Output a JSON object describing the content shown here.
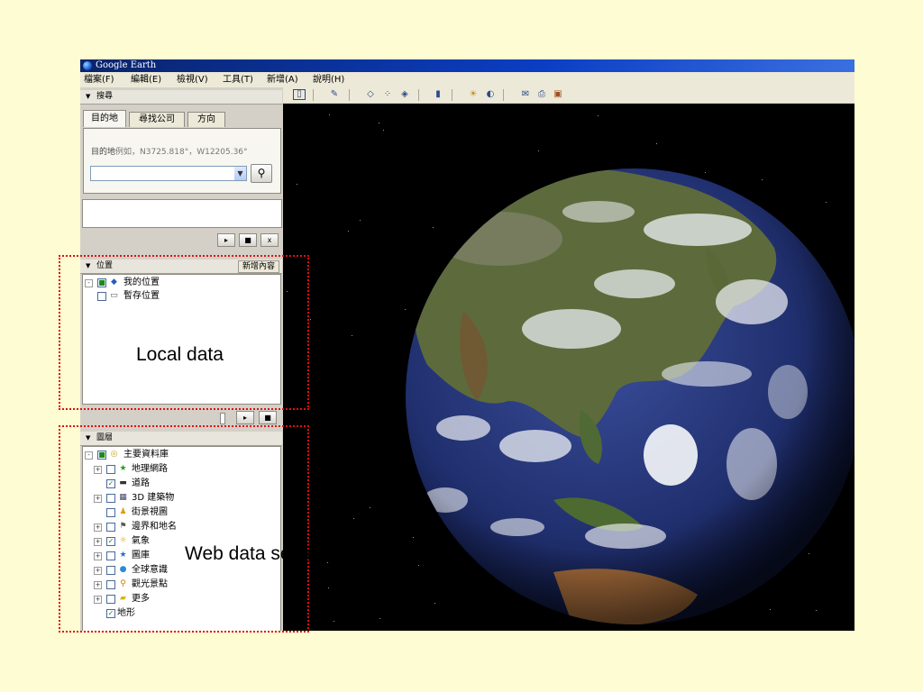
{
  "window": {
    "title": "Google Earth"
  },
  "menu": [
    "檔案(F)",
    "編輯(E)",
    "檢視(V)",
    "工具(T)",
    "新增(A)",
    "說明(H)"
  ],
  "search": {
    "header": "搜尋",
    "tabs": [
      "目的地",
      "尋找公司",
      "方向"
    ],
    "hint_label": "目的地",
    "hint_example": "例如，N3725.818°，W12205.36°",
    "go_icon": "magnifier-icon"
  },
  "controls": {
    "play": "▸",
    "stop": "■",
    "close": "x"
  },
  "places": {
    "header": "位置",
    "add_button": "新增內容",
    "items": [
      {
        "label": "我的位置",
        "checked": true,
        "icon": "layers-icon"
      },
      {
        "label": "暫存位置",
        "checked": false,
        "icon": "folder-icon"
      }
    ]
  },
  "layers": {
    "header": "圖層",
    "items": [
      {
        "label": "主要資料庫",
        "checked": true,
        "icon": "database-icon",
        "expand": "⊟"
      },
      {
        "label": "地理網路",
        "checked": false,
        "icon": "star-icon",
        "expand": "⊞"
      },
      {
        "label": "道路",
        "checked": true,
        "icon": "road-icon",
        "expand": ""
      },
      {
        "label": "3D 建築物",
        "checked": false,
        "icon": "building-icon",
        "expand": "⊞"
      },
      {
        "label": "街景視圖",
        "checked": false,
        "icon": "pegman-icon",
        "expand": ""
      },
      {
        "label": "邊界和地名",
        "checked": false,
        "icon": "flag-icon",
        "expand": "⊞"
      },
      {
        "label": "氣象",
        "checked": true,
        "icon": "sun-icon",
        "expand": "⊞"
      },
      {
        "label": "圖庫",
        "checked": false,
        "icon": "star-icon",
        "expand": "⊞"
      },
      {
        "label": "全球意識",
        "checked": false,
        "icon": "globe-icon",
        "expand": "⊞"
      },
      {
        "label": "觀光景點",
        "checked": false,
        "icon": "pin-icon",
        "expand": "⊞"
      },
      {
        "label": "更多",
        "checked": false,
        "icon": "folder-icon",
        "expand": "⊞"
      },
      {
        "label": "地形",
        "checked": true,
        "icon": "",
        "expand": ""
      }
    ]
  },
  "annotations": {
    "local": "Local data",
    "web": "Web data service"
  },
  "colors": {
    "desktop": "#fefcd2",
    "titlebar": "#0a246a",
    "annotation_border": "#e01010",
    "space": "#000000"
  }
}
